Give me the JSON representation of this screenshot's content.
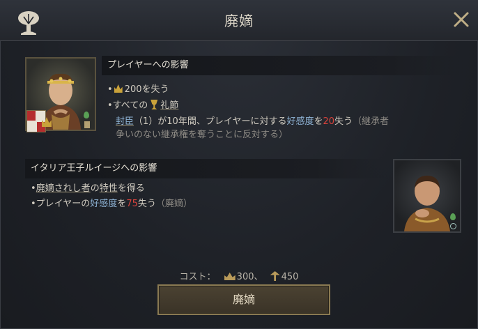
{
  "window": {
    "title": "廃嫡",
    "icons": {
      "header": "tree-icon",
      "close": "close-icon"
    }
  },
  "player_section": {
    "header": "プレイヤーへの影響",
    "bullet1_value": "200",
    "bullet1_text": "を失う",
    "bullet2_prefix": "すべての",
    "bullet2_link": "礼節",
    "line3": {
      "a": "封臣",
      "b": "（1）が10年間、プレイヤーに対する",
      "c": "好感度",
      "d": "を",
      "e": "20",
      "f": "失う",
      "g": "（継承者"
    },
    "line4": "争いのない継承権を奪うことに反対する）"
  },
  "heir_section": {
    "header": "イタリア王子ルイージへの影響",
    "bullet1_link": "廃嫡されし者",
    "bullet1_mid": "の",
    "bullet1_trait": "特性",
    "bullet1_end": "を得る",
    "bullet2_a": "プレイヤーの",
    "bullet2_b": "好感度",
    "bullet2_c": "を",
    "bullet2_d": "75",
    "bullet2_e": "失う",
    "bullet2_f": "（廃嫡）"
  },
  "cost": {
    "label": "コスト：",
    "prestige_value": "300、",
    "piety_value": "450"
  },
  "confirm_button": {
    "label": "廃嫡"
  },
  "colors": {
    "accent_blue": "#8fb4d6",
    "negative_red": "#d9433c",
    "button_border": "#8a7a52"
  }
}
